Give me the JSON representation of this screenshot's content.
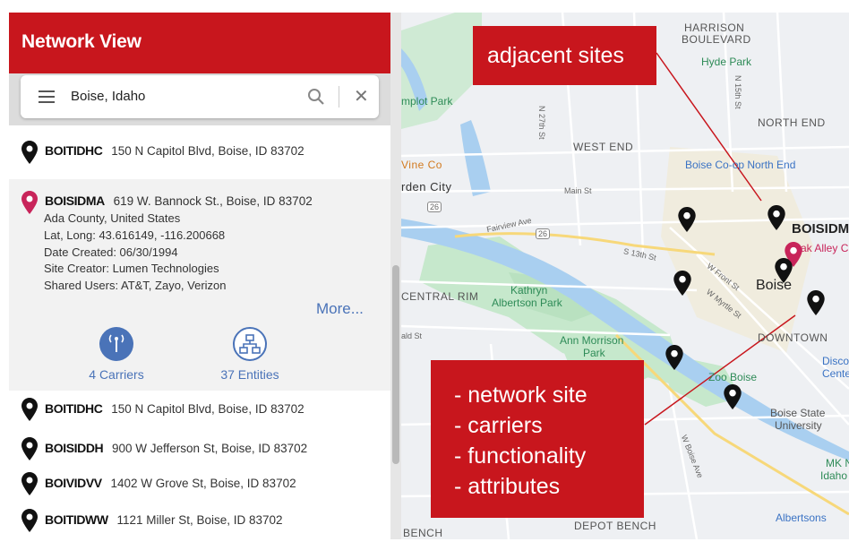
{
  "header": {
    "title": "Network View"
  },
  "search": {
    "value": "Boise, Idaho"
  },
  "sites_top": [
    {
      "code": "BOITIDHC",
      "address": "150 N Capitol Blvd, Boise, ID  83702"
    }
  ],
  "selected_site": {
    "code": "BOISIDMA",
    "address": "619 W. Bannock St., Boise, ID  83702",
    "details": [
      "Ada County, United States",
      "Lat, Long: 43.616149,  -116.200668",
      "Date Created: 06/30/1994",
      "Site Creator: Lumen Technologies",
      "Shared Users: AT&T, Zayo, Verizon"
    ],
    "more_label": "More...",
    "carriers_label": "4 Carriers",
    "entities_label": "37 Entities"
  },
  "sites_bottom": [
    {
      "code": "BOITIDHC",
      "address": "150 N Capitol Blvd, Boise, ID  83702"
    },
    {
      "code": "BOISIDDH",
      "address": "900 W Jefferson St, Boise, ID  83702"
    },
    {
      "code": "BOIVIDVV",
      "address": "1402 W Grove St, Boise, ID  83702"
    },
    {
      "code": "BOITIDWW",
      "address": "1121 Miller St, Boise, ID  83702"
    }
  ],
  "map": {
    "labels": {
      "harrison": "HARRISON",
      "boulevard": "BOULEVARD",
      "hyde_park": "Hyde Park",
      "north_end": "NORTH END",
      "west_end": "WEST END",
      "plot_park": "mplot Park",
      "vine_co": "Vine Co",
      "garden_city": "rden City",
      "main_st": "Main St",
      "fairview": "Fairview Ave",
      "boise_coop": "Boise Co-op North End",
      "boisidm": "BOISIDM",
      "oak_alley": "ak Alley C",
      "boise": "Boise",
      "central_rim": "CENTRAL RIM",
      "kathryn_1": "Kathryn",
      "kathryn_2": "Albertson Park",
      "ann_1": "Ann Morrison",
      "ann_2": "Park",
      "downtown": "DOWNTOWN",
      "zoo": "Zoo Boise",
      "disco_1": "Disco",
      "disco_2": "Cente",
      "bsu_1": "Boise State",
      "bsu_2": "University",
      "mk_1": "MK N",
      "mk_2": "Idaho",
      "depot": "DEPOT BENCH",
      "bench": "BENCH",
      "albertsons": "Albertsons",
      "n_27th": "N 27th St",
      "n_15th": "N 15th St",
      "s_13th": "S 13th St",
      "w_front": "W Front St",
      "w_myrtle": "W Myrtle St",
      "w_boise_ave": "W Boise Ave",
      "hwy_26": "26",
      "hwy_26b": "26",
      "ald_st": "ald St"
    },
    "callout_top": "adjacent sites",
    "callout_bottom": [
      "- network site",
      "- carriers",
      "- functionality",
      "- attributes"
    ]
  },
  "colors": {
    "brand_red": "#c8161d",
    "link_blue": "#4a73b8",
    "pin_black": "#111111",
    "pin_selected": "#c8245a"
  }
}
